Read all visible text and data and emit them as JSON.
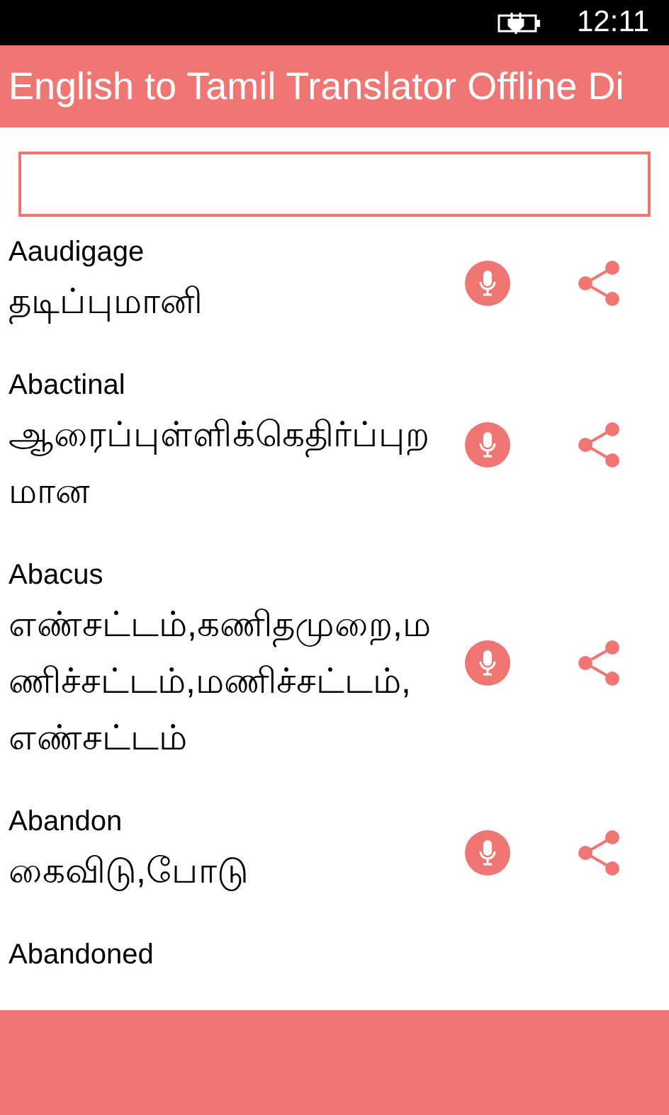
{
  "status_bar": {
    "time": "12:11"
  },
  "app_bar": {
    "title": "English to Tamil Translator Offline Di"
  },
  "entries": [
    {
      "word": "Aaudigage",
      "translation": "தடிப்புமானி"
    },
    {
      "word": "Abactinal",
      "translation": "ஆரைப்புள்ளிக்கெதிர்ப்புறமான"
    },
    {
      "word": "Abacus",
      "translation": "எண்சட்டம்,கணிதமுறை,மணிச்சட்டம்,மணிச்சட்டம்,எண்சட்டம்"
    },
    {
      "word": "Abandon",
      "translation": "கைவிடு,போடு"
    },
    {
      "word": "Abandoned"
    }
  ]
}
